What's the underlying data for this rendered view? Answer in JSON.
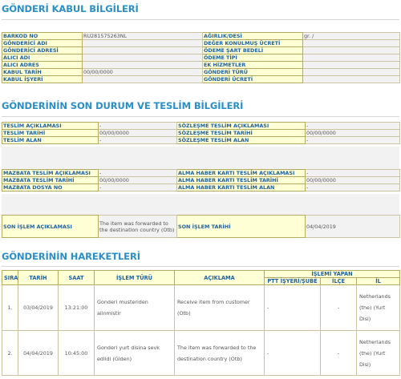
{
  "kabul": {
    "title": "GÖNDERİ KABUL BİLGİLERİ",
    "rows": [
      {
        "l1": "BARKOD NO",
        "v1": "RU281575263NL",
        "l2": "AĞIRLIK/DESİ",
        "v2": "gr. /"
      },
      {
        "l1": "GÖNDERİCİ ADI",
        "v1": "",
        "l2": "DEĞER KONULMUŞ ÜCRETİ",
        "v2": ""
      },
      {
        "l1": "GÖNDERİCİ ADRESİ",
        "v1": "",
        "l2": "ÖDEME ŞART BEDELİ",
        "v2": ""
      },
      {
        "l1": "ALICI ADI",
        "v1": "",
        "l2": "ÖDEME TİPİ",
        "v2": ""
      },
      {
        "l1": "ALICI ADRES",
        "v1": "",
        "l2": "EK HİZMETLER",
        "v2": ""
      },
      {
        "l1": "KABUL TARİH",
        "v1": "00/00/0000",
        "l2": "GÖNDERİ TÜRÜ",
        "v2": ""
      },
      {
        "l1": "KABUL İŞYERİ",
        "v1": "",
        "l2": "GÖNDERİ ÜCRETİ",
        "v2": ""
      }
    ]
  },
  "teslim": {
    "title": "GÖNDERİNİN SON DURUM VE TESLİM BİLGİLERİ",
    "rows1": [
      {
        "l1": "TESLİM AÇIKLAMASI",
        "v1": "-",
        "l2": "SÖZLEŞME TESLİM AÇIKLAMASI",
        "v2": "-"
      },
      {
        "l1": "TESLİM TARİHİ",
        "v1": "00/00/0000",
        "l2": "SÖZLEŞME TESLİM TARİHİ",
        "v2": "00/00/0000"
      },
      {
        "l1": "TESLİM ALAN",
        "v1": "-",
        "l2": "SÖZLEŞME TESLİM ALAN",
        "v2": "-"
      }
    ],
    "rows2": [
      {
        "l1": "MAZBATA TESLİM AÇIKLAMASI",
        "v1": "-",
        "l2": "ALMA HABER KARTI TESLİM AÇIKLAMASI",
        "v2": "-"
      },
      {
        "l1": "MAZBATA TESLİM TARİHİ",
        "v1": "00/00/0000",
        "l2": "ALMA HABER KARTI TESLİM TARİHİ",
        "v2": "00/00/0000"
      },
      {
        "l1": "MAZBATA DOSYA NO",
        "v1": "-",
        "l2": "ALMA HABER KARTI TESLİM ALAN",
        "v2": "-"
      }
    ],
    "son": {
      "l1": "SON İŞLEM AÇIKLAMASI",
      "v1": "The item was forwarded to the destination country (Otb)",
      "l2": "SON İŞLEM TARİHİ",
      "v2": "04/04/2019"
    }
  },
  "hareket": {
    "title": "GÖNDERİNİN HAREKETLERİ",
    "headers": {
      "sira": "SIRA",
      "tarih": "TARİH",
      "saat": "SAAT",
      "tur": "İŞLEM TÜRÜ",
      "aciklama": "AÇIKLAMA",
      "yapan": "İŞLEMİ YAPAN",
      "ptt": "PTT İŞYERİ/ŞUBE",
      "ilce": "İLÇE",
      "il": "İL"
    },
    "rows": [
      {
        "sira": "1.",
        "tarih": "03/04/2019",
        "saat": "13:21:00",
        "tur": "Gonderi musteriden alinmistir",
        "aciklama": "Receive item from customer (Otb)",
        "ptt": "-",
        "ilce": "-",
        "il": "Netherlands (the) (Yurt Disi)"
      },
      {
        "sira": "2.",
        "tarih": "04/04/2019",
        "saat": "10:45:00",
        "tur": "Gonderi yurt disina sevk edildi (Giden)",
        "aciklama": "The item was forwarded to the destination country (Otb)",
        "ptt": "-",
        "ilce": "-",
        "il": "Netherlands (the) (Yurt Disi)"
      }
    ]
  }
}
